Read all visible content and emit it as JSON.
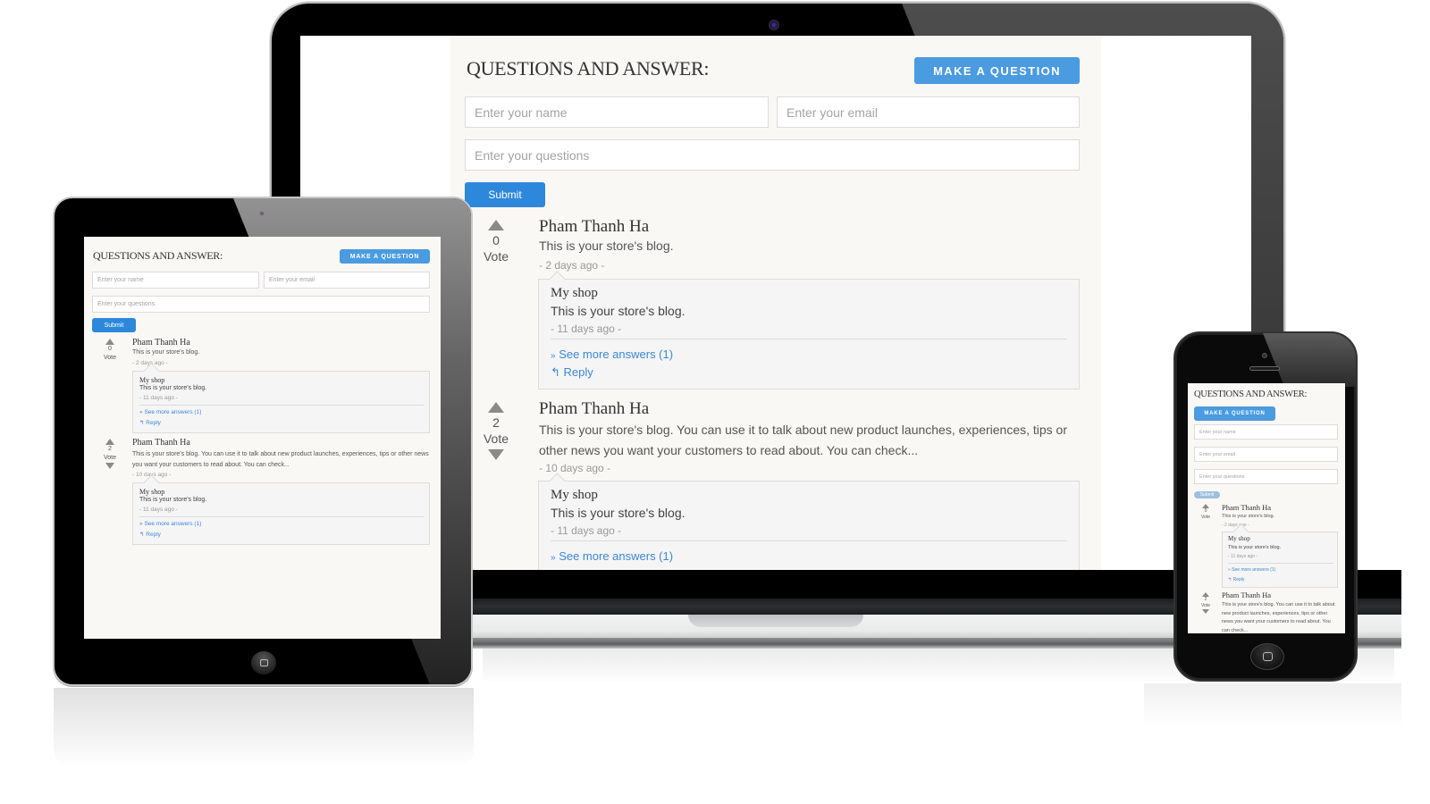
{
  "app": {
    "title": "QUESTIONS AND ANSWER:",
    "make_question_label": "MAKE A QUESTION",
    "name_placeholder": "Enter your name",
    "email_placeholder": "Enter your email",
    "question_placeholder": "Enter your questions",
    "submit_label": "Submit",
    "vote_label": "Vote",
    "see_more_label": "See more answers (1)",
    "reply_label": "Reply",
    "accent_color": "#4a9be0",
    "submit_color": "#2d88db",
    "link_color": "#3b88d6"
  },
  "questions": [
    {
      "votes": "0",
      "author": "Pham Thanh Ha",
      "body": "This is your store's blog.",
      "time": "- 2 days ago -",
      "has_downvote": false,
      "answer": {
        "author": "My shop",
        "body": "This is your store's blog.",
        "time": "- 11 days ago -"
      }
    },
    {
      "votes": "2",
      "author": "Pham Thanh Ha",
      "body": "This is your store's blog. You can use it to talk about new product launches, experiences, tips or other news you want your customers to read about. You can check...",
      "time": "- 10 days ago -",
      "has_downvote": true,
      "answer": {
        "author": "My shop",
        "body": "This is your store's blog.",
        "time": "- 11 days ago -"
      }
    }
  ],
  "devices": [
    "laptop",
    "tablet",
    "phone"
  ]
}
